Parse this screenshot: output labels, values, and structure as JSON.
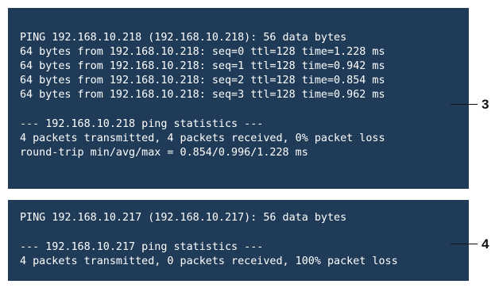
{
  "terminal_1": {
    "lines": [
      "PING 192.168.10.218 (192.168.10.218): 56 data bytes",
      "64 bytes from 192.168.10.218: seq=0 ttl=128 time=1.228 ms",
      "64 bytes from 192.168.10.218: seq=1 ttl=128 time=0.942 ms",
      "64 bytes from 192.168.10.218: seq=2 ttl=128 time=0.854 ms",
      "64 bytes from 192.168.10.218: seq=3 ttl=128 time=0.962 ms",
      "--- 192.168.10.218 ping statistics ---",
      "4 packets transmitted, 4 packets received, 0% packet loss",
      "round-trip min/avg/max = 0.854/0.996/1.228 ms"
    ],
    "callout": "3"
  },
  "terminal_2": {
    "lines": [
      "PING 192.168.10.217 (192.168.10.217): 56 data bytes",
      "--- 192.168.10.217 ping statistics ---",
      "4 packets transmitted, 0 packets received, 100% packet loss"
    ],
    "callout": "4"
  },
  "colors": {
    "terminal_background": "#1f3b57",
    "terminal_text": "#ffffff",
    "callout": "#111111"
  }
}
